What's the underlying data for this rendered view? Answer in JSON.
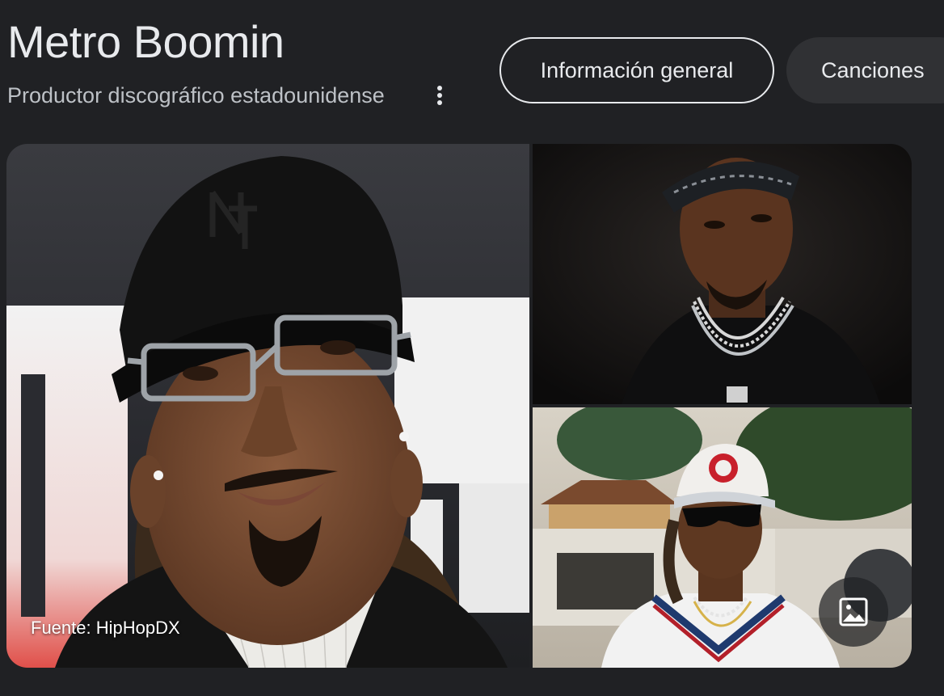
{
  "entity": {
    "title": "Metro Boomin",
    "subtitle": "Productor discográfico estadounidense"
  },
  "tabs": [
    {
      "label": "Información general",
      "active": true
    },
    {
      "label": "Canciones",
      "active": false
    }
  ],
  "gallery": {
    "source_label": "Fuente: HipHopDX",
    "icons": {
      "more": "more-vert-icon",
      "images": "image-icon"
    }
  },
  "colors": {
    "background": "#202124",
    "text_primary": "#e8eaed",
    "text_secondary": "#bdc1c6",
    "chip_fill": "#303134"
  }
}
